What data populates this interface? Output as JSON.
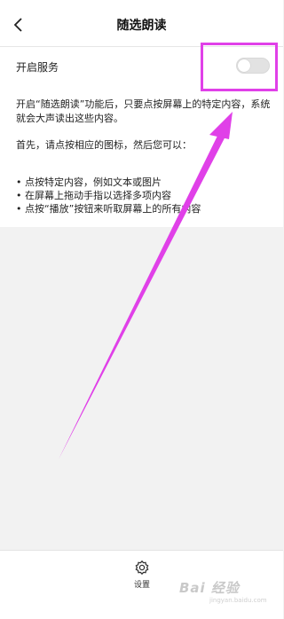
{
  "header": {
    "title": "随选朗读"
  },
  "service": {
    "label": "开启服务",
    "toggle_on": false
  },
  "description": {
    "intro": "开启“随选朗读”功能后，只要点按屏幕上的特定内容，系统就会大声读出这些内容。",
    "step": "首先，请点按相应的图标，然后您可以："
  },
  "bullets": [
    "• 点按特定内容，例如文本或图片",
    "• 在屏幕上拖动手指以选择多项内容",
    "• 点按“播放”按钮来听取屏幕上的所有内容"
  ],
  "bottom": {
    "settings_label": "设置"
  },
  "watermark": {
    "text": "Bai 经验",
    "sub": "jingyan.baidu.com"
  },
  "colors": {
    "annotation": "#e040e8",
    "toggle_off": "#e2e2e2",
    "background": "#f2f2f2"
  }
}
